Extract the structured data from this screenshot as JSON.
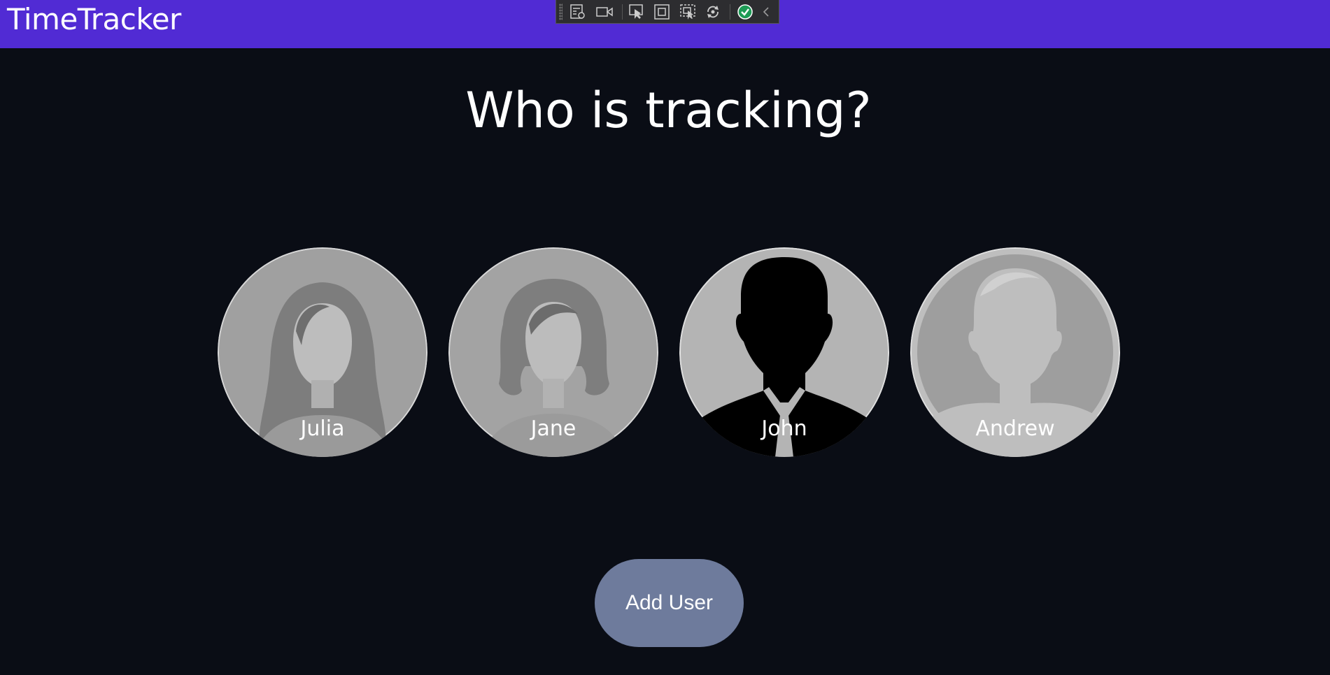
{
  "header": {
    "title": "TimeTracker",
    "background": "#512bd4"
  },
  "debug_toolbar": {
    "icons": [
      "live-visual-tree-icon",
      "record-icon",
      "select-element-icon",
      "display-layout-adorners-icon",
      "track-focused-element-icon",
      "hot-reload-icon",
      "hot-reload-status-icon",
      "collapse-chevron-icon"
    ]
  },
  "main": {
    "heading": "Who is tracking?",
    "users": [
      {
        "name": "Julia",
        "avatar": "female-long-hair-silhouette"
      },
      {
        "name": "Jane",
        "avatar": "female-curly-hair-silhouette"
      },
      {
        "name": "John",
        "avatar": "male-suit-silhouette"
      },
      {
        "name": "Andrew",
        "avatar": "male-short-hair-silhouette"
      }
    ],
    "add_user_label": "Add User",
    "add_user_color": "#6e7b9c"
  }
}
